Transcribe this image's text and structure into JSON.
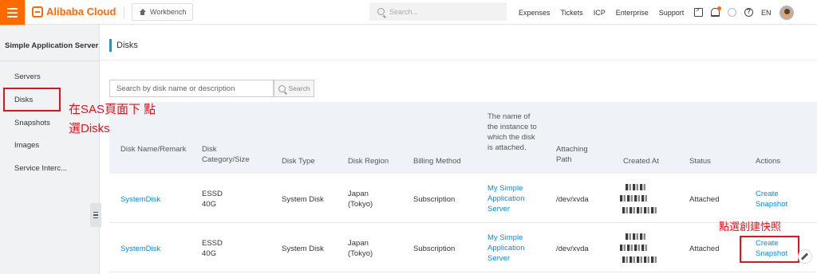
{
  "topbar": {
    "brand": "Alibaba Cloud",
    "workbench": "Workbench",
    "search_placeholder": "Search...",
    "links": [
      "Expenses",
      "Tickets",
      "ICP",
      "Enterprise",
      "Support"
    ],
    "language": "EN",
    "icons": [
      "terminal-icon",
      "bell-icon",
      "lightbulb-icon",
      "help-icon"
    ]
  },
  "sidebar": {
    "title": "Simple Application Server",
    "items": [
      {
        "label": "Servers"
      },
      {
        "label": "Disks"
      },
      {
        "label": "Snapshots"
      },
      {
        "label": "Images"
      },
      {
        "label": "Service Interc..."
      }
    ]
  },
  "page": {
    "title": "Disks",
    "search_placeholder": "Search by disk name or description",
    "search_button": "Search"
  },
  "table": {
    "headers": [
      "Disk Name/Remark",
      "Disk Category/Size",
      "Disk Type",
      "Disk Region",
      "Billing Method",
      "The name of the instance to which the disk is attached.",
      "Attaching Path",
      "Created At",
      "Status",
      "Actions"
    ],
    "rows": [
      {
        "name": "SystemDisk",
        "category": "ESSD",
        "size": "40G",
        "type": "System Disk",
        "region1": "Japan",
        "region2": "(Tokyo)",
        "billing": "Subscription",
        "instance1": "My Simple",
        "instance2": "Application",
        "instance3": "Server",
        "path": "/dev/xvda",
        "status": "Attached",
        "action1": "Create",
        "action2": "Snapshot"
      },
      {
        "name": "SystemDisk",
        "category": "ESSD",
        "size": "40G",
        "type": "System Disk",
        "region1": "Japan",
        "region2": "(Tokyo)",
        "billing": "Subscription",
        "instance1": "My Simple",
        "instance2": "Application",
        "instance3": "Server",
        "path": "/dev/xvda",
        "status": "Attached",
        "action1": "Create",
        "action2": "Snapshot"
      }
    ]
  },
  "annotations": {
    "sidebar_note_line1": "在SAS頁面下 點",
    "sidebar_note_line2": "選Disks",
    "action_note": "點選創建快照",
    "color": "#e0141e"
  },
  "colors": {
    "accent": "#ff6a00",
    "link": "#0b8bd9",
    "title_bar": "#00a1d6"
  }
}
